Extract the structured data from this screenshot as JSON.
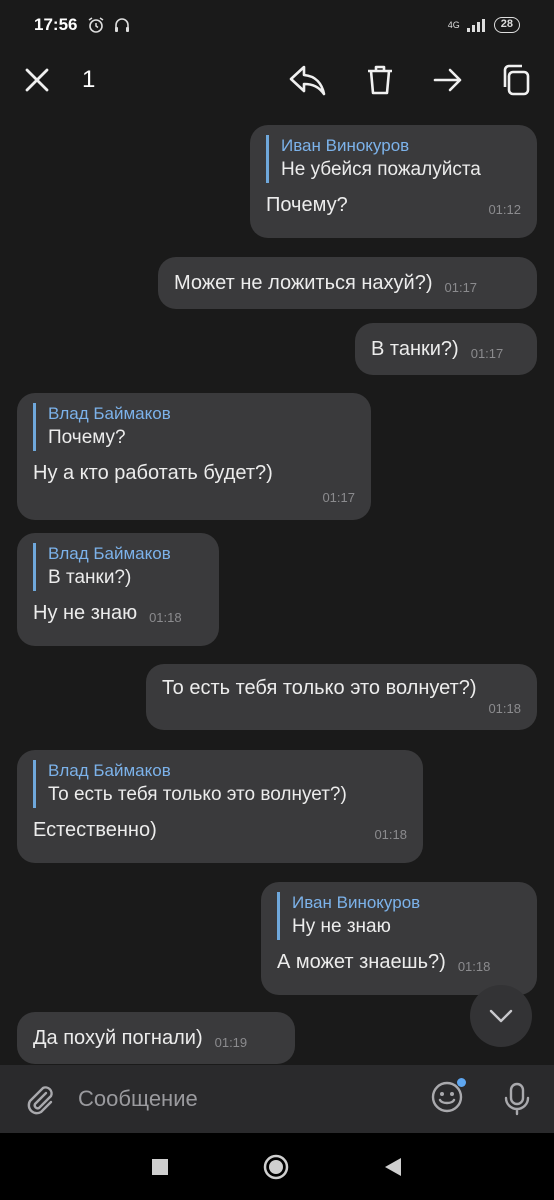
{
  "status": {
    "time": "17:56",
    "network": "4G",
    "battery": "28"
  },
  "toolbar": {
    "selected_count": "1"
  },
  "messages": [
    {
      "reply_name": "Иван Винокуров",
      "reply_text": "Не убейся пожалуйста",
      "text": "Почему?",
      "time": "01:12"
    },
    {
      "text": "Может не ложиться нахуй?)",
      "time": "01:17"
    },
    {
      "text": "В танки?)",
      "time": "01:17"
    },
    {
      "reply_name": "Влад Баймаков",
      "reply_text": "Почему?",
      "text": "Ну а кто работать будет?)",
      "time": "01:17"
    },
    {
      "reply_name": "Влад Баймаков",
      "reply_text": "В танки?)",
      "text": "Ну не знаю",
      "time": "01:18"
    },
    {
      "text": "То есть тебя только это волнует?)",
      "time": "01:18"
    },
    {
      "reply_name": "Влад Баймаков",
      "reply_text": "То есть тебя только это волнует?)",
      "text": "Естественно)",
      "time": "01:18"
    },
    {
      "reply_name": "Иван Винокуров",
      "reply_text": "Ну не знаю",
      "text": "А может знаешь?)",
      "time": "01:18"
    },
    {
      "text": "Да похуй погнали)",
      "time": "01:19"
    }
  ],
  "composer": {
    "placeholder": "Сообщение"
  }
}
